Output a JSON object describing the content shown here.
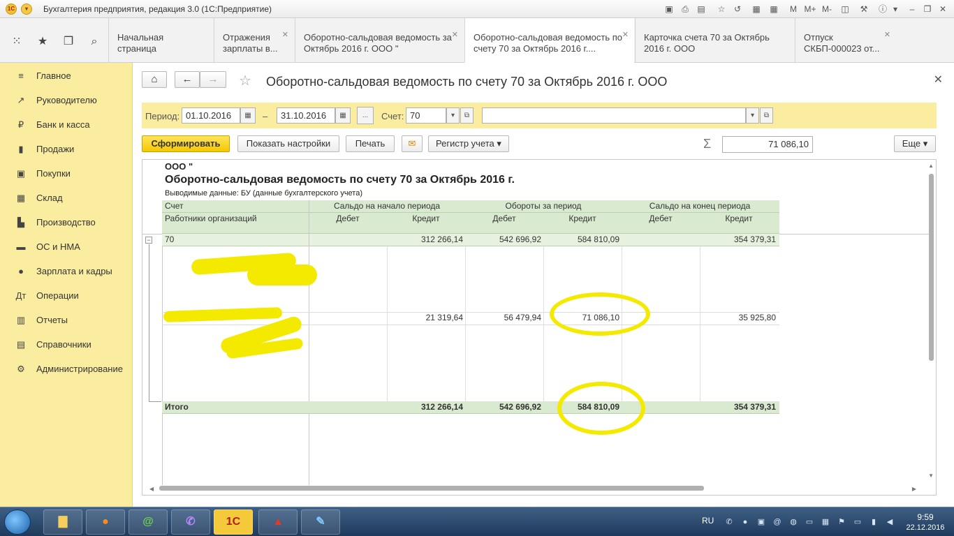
{
  "window": {
    "title": "Бухгалтерия предприятия, редакция 3.0  (1С:Предприятие)",
    "logo": "1С"
  },
  "tabs": [
    {
      "label": "Начальная страница"
    },
    {
      "label": "Отражения зарплаты в..."
    },
    {
      "label": "Оборотно-сальдовая ведомость за Октябрь 2016 г. ООО \""
    },
    {
      "label": "Оборотно-сальдовая ведомость по счету 70 за Октябрь 2016 г...."
    },
    {
      "label": "Карточка счета 70 за Октябрь 2016 г. ООО"
    },
    {
      "label": "Отпуск СКБП-000023 от..."
    }
  ],
  "sidebar": {
    "items": [
      {
        "label": "Главное",
        "icon": "menu-icon"
      },
      {
        "label": "Руководителю",
        "icon": "trend-icon"
      },
      {
        "label": "Банк и касса",
        "icon": "ruble-icon"
      },
      {
        "label": "Продажи",
        "icon": "bag-icon"
      },
      {
        "label": "Покупки",
        "icon": "cart-icon"
      },
      {
        "label": "Склад",
        "icon": "warehouse-icon"
      },
      {
        "label": "Производство",
        "icon": "factory-icon"
      },
      {
        "label": "ОС и НМА",
        "icon": "truck-icon"
      },
      {
        "label": "Зарплата и кадры",
        "icon": "people-icon"
      },
      {
        "label": "Операции",
        "icon": "operations-icon"
      },
      {
        "label": "Отчеты",
        "icon": "chart-icon"
      },
      {
        "label": "Справочники",
        "icon": "book-icon"
      },
      {
        "label": "Администрирование",
        "icon": "gear-icon"
      }
    ]
  },
  "form": {
    "title": "Оборотно-сальдовая ведомость по счету 70 за Октябрь 2016 г. ООО",
    "period_label": "Период:",
    "period_from": "01.10.2016",
    "period_dash": "–",
    "period_to": "31.10.2016",
    "period_more": "...",
    "account_label": "Счет:",
    "account_value": "70",
    "buttons": {
      "generate": "Сформировать",
      "settings": "Показать настройки",
      "print": "Печать",
      "register": "Регистр учета",
      "more": "Еще"
    },
    "sum_value": "71 086,10"
  },
  "report": {
    "org": "ООО \"",
    "title": "Оборотно-сальдовая ведомость по счету 70 за Октябрь 2016 г.",
    "output_label": "Выводимые данные:  БУ (данные бухгалтерского учета)",
    "headers": {
      "account": "Счет",
      "employees": "Работники организаций",
      "opening": "Сальдо на начало периода",
      "turnover": "Обороты за период",
      "closing": "Сальдо на конец периода",
      "debit": "Дебет",
      "credit": "Кредит"
    },
    "row_70": {
      "account": "70",
      "opening_credit": "312 266,14",
      "turnover_debit": "542 696,92",
      "turnover_credit": "584 810,09",
      "closing_credit": "354 379,31"
    },
    "row_employee": {
      "opening_credit": "21 319,64",
      "turnover_debit": "56 479,94",
      "turnover_credit": "71 086,10",
      "closing_credit": "35 925,80"
    },
    "total": {
      "label": "Итого",
      "opening_credit": "312 266,14",
      "turnover_debit": "542 696,92",
      "turnover_credit": "584 810,09",
      "closing_credit": "354 379,31"
    }
  },
  "taskbar": {
    "lang": "RU",
    "time": "9:59",
    "date": "22.12.2016",
    "apps": [
      "explorer-icon",
      "firefox-icon",
      "mail-icon",
      "viber-icon",
      "1c-icon",
      "pdf-icon",
      "paint-icon"
    ],
    "app_1c_label": "1С"
  },
  "colors": {
    "sidebar_bg": "#fbeda0",
    "primary_button": "#f5c800",
    "table_header": "#d9ead0",
    "highlight_marker": "#f4ea00"
  }
}
